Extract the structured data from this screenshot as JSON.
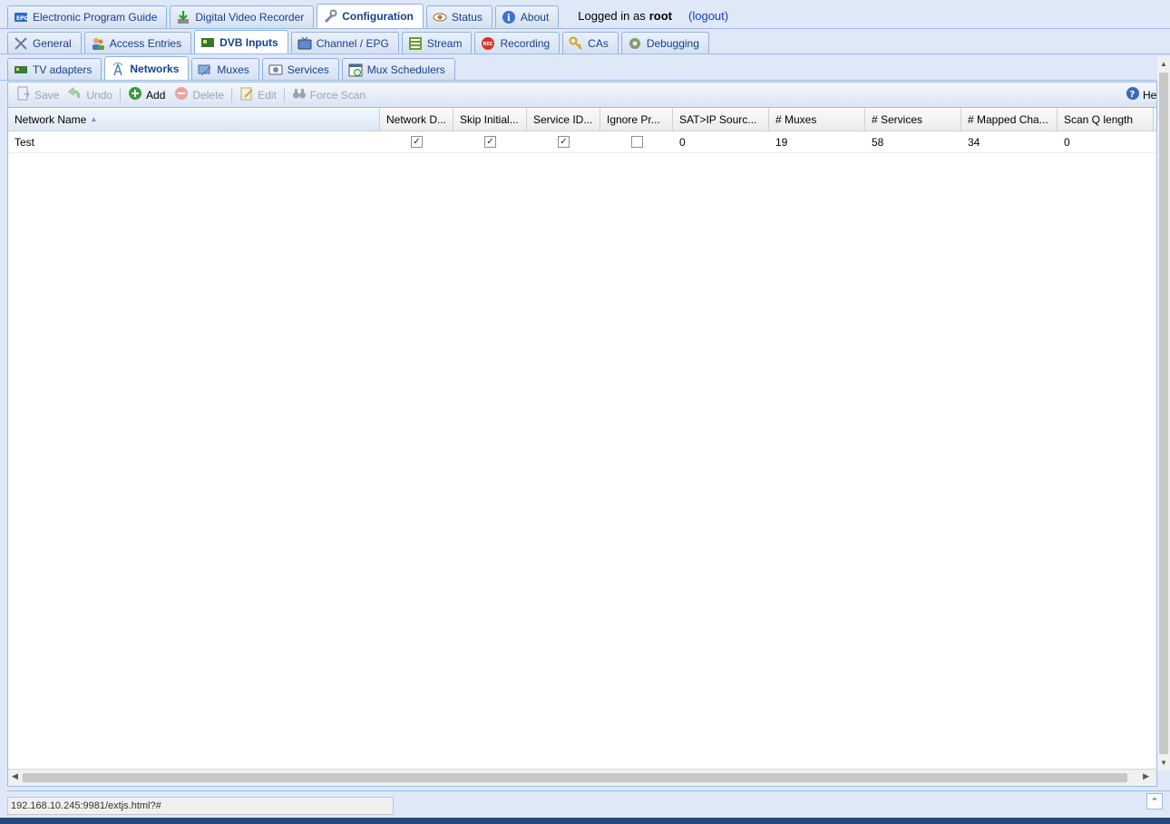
{
  "main_tabs": [
    {
      "label": "Electronic Program Guide",
      "icon": "epg-icon"
    },
    {
      "label": "Digital Video Recorder",
      "icon": "download-icon"
    },
    {
      "label": "Configuration",
      "icon": "wrench-icon",
      "active": true
    },
    {
      "label": "Status",
      "icon": "eye-icon"
    },
    {
      "label": "About",
      "icon": "info-icon"
    }
  ],
  "login": {
    "prefix": "Logged in as",
    "user": "root",
    "logout": "(logout)"
  },
  "config_tabs": [
    {
      "label": "General",
      "icon": "tools-icon"
    },
    {
      "label": "Access Entries",
      "icon": "users-icon"
    },
    {
      "label": "DVB Inputs",
      "icon": "card-icon",
      "active": true
    },
    {
      "label": "Channel / EPG",
      "icon": "tv-icon"
    },
    {
      "label": "Stream",
      "icon": "stream-icon"
    },
    {
      "label": "Recording",
      "icon": "rec-icon"
    },
    {
      "label": "CAs",
      "icon": "key-icon"
    },
    {
      "label": "Debugging",
      "icon": "debug-icon"
    }
  ],
  "dvb_tabs": [
    {
      "label": "TV adapters",
      "icon": "adapter-icon"
    },
    {
      "label": "Networks",
      "icon": "antenna-icon",
      "active": true
    },
    {
      "label": "Muxes",
      "icon": "muxes-icon"
    },
    {
      "label": "Services",
      "icon": "services-icon"
    },
    {
      "label": "Mux Schedulers",
      "icon": "calendar-icon"
    }
  ],
  "toolbar": {
    "save": "Save",
    "undo": "Undo",
    "add": "Add",
    "delete": "Delete",
    "edit": "Edit",
    "force_scan": "Force Scan",
    "help": "Help"
  },
  "grid": {
    "columns": [
      "Network Name",
      "Network D...",
      "Skip Initial...",
      "Service ID...",
      "Ignore Pr...",
      "SAT>IP Sourc...",
      "# Muxes",
      "# Services",
      "# Mapped Cha...",
      "Scan Q length"
    ],
    "rows": [
      {
        "name": "Test",
        "network_discovery": true,
        "skip_initial_scan": true,
        "service_id": true,
        "ignore_provider": false,
        "satip_source": "0",
        "muxes": "19",
        "services": "58",
        "mapped_channels": "34",
        "scan_q_length": "0"
      }
    ]
  },
  "statusbar": {
    "url": "192.168.10.245:9981/extjs.html?#"
  }
}
